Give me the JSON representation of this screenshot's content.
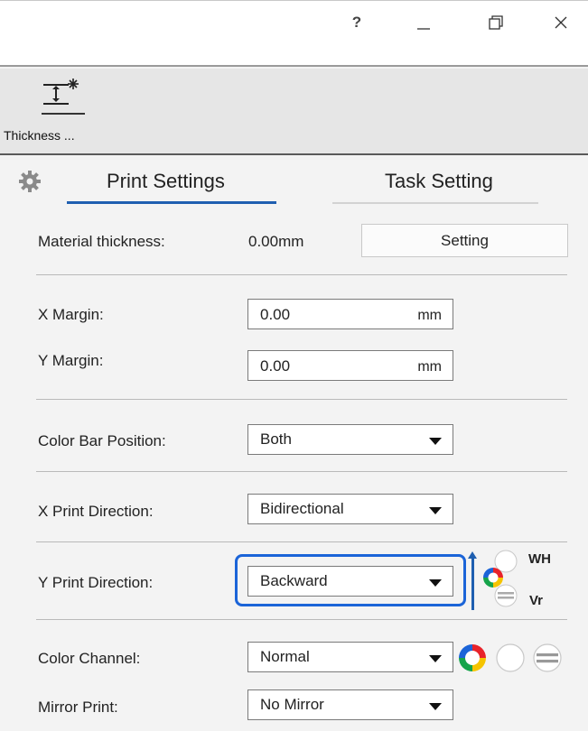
{
  "window": {
    "help_label": "?",
    "minimize_icon": "minimize-icon",
    "restore_icon": "restore-icon",
    "close_icon": "close-icon"
  },
  "ribbon": {
    "thickness_label": "Thickness ...",
    "thickness_icon": "thickness-icon"
  },
  "tabs": {
    "print_settings": "Print Settings",
    "task_setting": "Task Setting",
    "active": "Print Settings"
  },
  "material": {
    "label": "Material thickness:",
    "value": "0.00mm",
    "setting_button": "Setting"
  },
  "margins": {
    "x_label": "X Margin:",
    "x_value": "0.00",
    "x_unit": "mm",
    "y_label": "Y Margin:",
    "y_value": "0.00",
    "y_unit": "mm"
  },
  "color_bar": {
    "label": "Color Bar Position:",
    "selected": "Both"
  },
  "x_direction": {
    "label": "X Print Direction:",
    "selected": "Bidirectional"
  },
  "y_direction": {
    "label": "Y Print Direction:",
    "selected": "Backward",
    "wh_label": "WH",
    "vr_label": "Vr"
  },
  "color_channel": {
    "label": "Color Channel:",
    "selected": "Normal"
  },
  "mirror": {
    "label": "Mirror Print:",
    "selected": "No Mirror"
  },
  "colors": {
    "accent": "#1f5fb0",
    "highlight": "#1b64d8"
  }
}
